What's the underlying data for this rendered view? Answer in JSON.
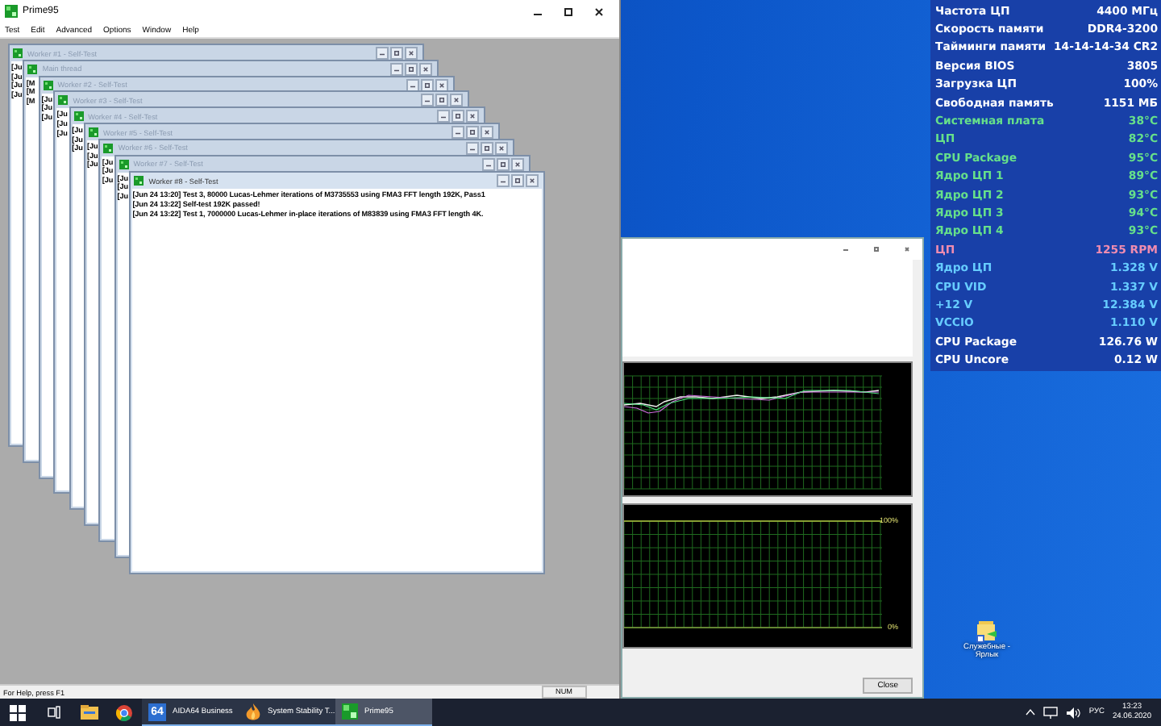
{
  "prime95": {
    "title": "Prime95",
    "menu": [
      "Test",
      "Edit",
      "Advanced",
      "Options",
      "Window",
      "Help"
    ],
    "children": [
      {
        "title": "Worker #1 - Self-Test",
        "peek": [
          "[Ju",
          "[Ju",
          "[Ju",
          "[Ju"
        ]
      },
      {
        "title": "Main thread",
        "peek": [
          "[M",
          "[M",
          "[M"
        ]
      },
      {
        "title": "Worker #2 - Self-Test",
        "peek": [
          "[Ju",
          "[Ju",
          "[Ju"
        ]
      },
      {
        "title": "Worker #3 - Self-Test",
        "peek": [
          "[Ju",
          "[Ju",
          "[Ju"
        ]
      },
      {
        "title": "Worker #4 - Self-Test",
        "peek": [
          "[Ju",
          "[Ju",
          "[Ju"
        ]
      },
      {
        "title": "Worker #5 - Self-Test",
        "peek": [
          "[Ju",
          "[Ju",
          "[Ju"
        ]
      },
      {
        "title": "Worker #6 - Self-Test",
        "peek": [
          "[Ju",
          "[Ju",
          "[Ju"
        ]
      },
      {
        "title": "Worker #7 - Self-Test",
        "peek": [
          "[Ju",
          "[Ju",
          "[Ju"
        ]
      }
    ],
    "front": {
      "title": "Worker #8 - Self-Test",
      "lines": [
        "[Jun 24 13:20] Test 3, 80000 Lucas-Lehmer iterations of M3735553 using FMA3 FFT length 192K, Pass1",
        "[Jun 24 13:22] Self-test 192K passed!",
        "[Jun 24 13:22] Test 1, 7000000 Lucas-Lehmer in-place iterations of M83839 using FMA3 FFT length 4K."
      ]
    },
    "status_bar": {
      "text": "For Help, press F1",
      "indicator": "NUM"
    }
  },
  "stability": {
    "top_label": "100%",
    "bottom_label": "0%",
    "button": "Close"
  },
  "sensors": [
    {
      "label": "Частота ЦП",
      "value": "4400 МГц",
      "color": "#ffffff"
    },
    {
      "label": "Скорость памяти",
      "value": "DDR4-3200",
      "color": "#ffffff"
    },
    {
      "label": "Тайминги памяти",
      "value": "14-14-14-34 CR2",
      "color": "#ffffff"
    },
    {
      "label": "Версия BIOS",
      "value": "3805",
      "color": "#ffffff"
    },
    {
      "label": "Загрузка ЦП",
      "value": "100%",
      "color": "#ffffff"
    },
    {
      "label": "Свободная память",
      "value": "1151 МБ",
      "color": "#ffffff"
    },
    {
      "label": "Системная плата",
      "value": "38°C",
      "color": "#66e08a"
    },
    {
      "label": "ЦП",
      "value": "82°C",
      "color": "#66e08a"
    },
    {
      "label": "CPU Package",
      "value": "95°C",
      "color": "#66e08a"
    },
    {
      "label": "Ядро ЦП 1",
      "value": "89°C",
      "color": "#66e08a"
    },
    {
      "label": "Ядро ЦП 2",
      "value": "93°C",
      "color": "#66e08a"
    },
    {
      "label": "Ядро ЦП 3",
      "value": "94°C",
      "color": "#66e08a"
    },
    {
      "label": "Ядро ЦП 4",
      "value": "93°C",
      "color": "#66e08a"
    },
    {
      "label": "ЦП",
      "value": "1255 RPM",
      "color": "#f08cb0"
    },
    {
      "label": "Ядро ЦП",
      "value": "1.328 V",
      "color": "#66ccff"
    },
    {
      "label": "CPU VID",
      "value": "1.337 V",
      "color": "#66ccff"
    },
    {
      "label": "+12 V",
      "value": "12.384 V",
      "color": "#66ccff"
    },
    {
      "label": "VCCIO",
      "value": "1.110 V",
      "color": "#66ccff"
    },
    {
      "label": "CPU Package",
      "value": "126.76 W",
      "color": "#ffffff"
    },
    {
      "label": "CPU Uncore",
      "value": "0.12 W",
      "color": "#ffffff"
    }
  ],
  "desktop_icon": {
    "label": "Служебные - Ярлык"
  },
  "taskbar": {
    "pinned": [
      {
        "kind": "explorer"
      },
      {
        "kind": "browser"
      }
    ],
    "apps": [
      {
        "kind": "aida",
        "badge": "64",
        "label": "AIDA64 Business",
        "selected": false
      },
      {
        "kind": "flame",
        "label": "System Stability T...",
        "selected": false
      },
      {
        "kind": "tiles",
        "label": "Prime95",
        "selected": true
      }
    ],
    "tray": {
      "language": "РУС",
      "time": "13:23",
      "date": "24.06.2020"
    }
  }
}
